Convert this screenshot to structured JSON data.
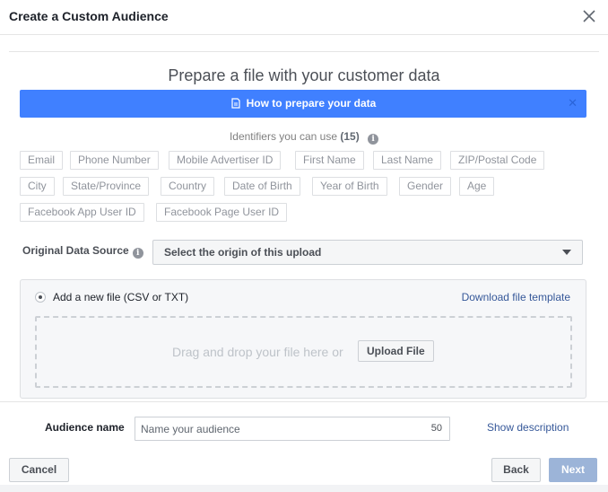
{
  "dialog": {
    "title": "Create a Custom Audience",
    "close_icon": "close-icon"
  },
  "prepare": {
    "heading": "Prepare a file with your customer data",
    "banner_label": "How to prepare your data",
    "banner_icon": "document-icon",
    "banner_color": "#4080ff"
  },
  "identifiers": {
    "heading_prefix": "Identifiers you can use",
    "count": "(15)",
    "rows": [
      [
        "Email",
        "Phone Number",
        "Mobile Advertiser ID",
        "First Name",
        "Last Name",
        "ZIP/Postal Code"
      ],
      [
        "City",
        "State/Province",
        "Country",
        "Date of Birth",
        "Year of Birth",
        "Gender",
        "Age"
      ],
      [
        "Facebook App User ID",
        "Facebook Page User ID"
      ]
    ]
  },
  "data_source": {
    "label": "Original Data Source",
    "selected": "Select the origin of this upload"
  },
  "upload": {
    "radio_label": "Add a new file (CSV or TXT)",
    "template_link": "Download file template",
    "drop_text": "Drag and drop your file here or",
    "upload_button": "Upload File"
  },
  "audience": {
    "label": "Audience name",
    "placeholder": "Name your audience",
    "char_count": "50",
    "show_description": "Show description"
  },
  "footer": {
    "cancel": "Cancel",
    "back": "Back",
    "next": "Next"
  }
}
